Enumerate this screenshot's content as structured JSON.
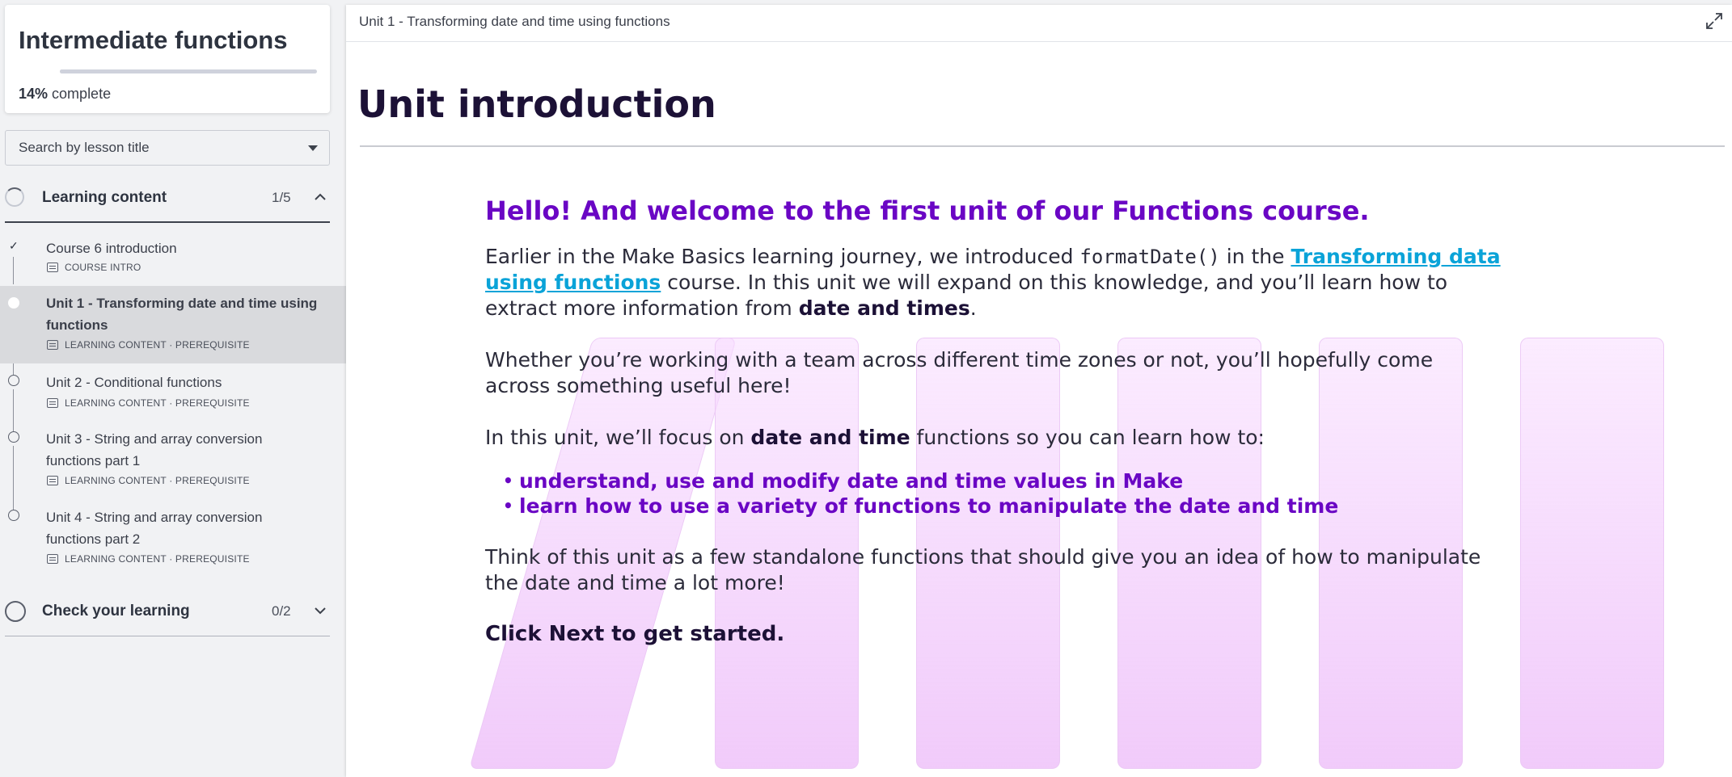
{
  "course": {
    "title": "Intermediate functions",
    "progress_value": 14,
    "progress_pct": "14%",
    "progress_label": "complete"
  },
  "search": {
    "placeholder": "Search by lesson title"
  },
  "sections": [
    {
      "label": "Learning content",
      "count": "1/5",
      "expanded": true
    },
    {
      "label": "Check your learning",
      "count": "0/2",
      "expanded": false
    }
  ],
  "lessons": [
    {
      "title": "Course 6 introduction",
      "meta": "COURSE INTRO",
      "status": "complete"
    },
    {
      "title": "Unit 1 - Transforming date and time using functions",
      "meta": "LEARNING CONTENT · PREREQUISITE",
      "status": "current"
    },
    {
      "title": "Unit 2 - Conditional functions",
      "meta": "LEARNING CONTENT · PREREQUISITE",
      "status": "not-started"
    },
    {
      "title": "Unit 3 - String and array conversion functions part 1",
      "meta": "LEARNING CONTENT · PREREQUISITE",
      "status": "not-started"
    },
    {
      "title": "Unit 4 - String and array conversion functions part 2",
      "meta": "LEARNING CONTENT · PREREQUISITE",
      "status": "not-started"
    }
  ],
  "topbar": {
    "breadcrumb": "Unit 1 - Transforming date and time using functions",
    "expand_icon": "expand-icon"
  },
  "page": {
    "title": "Unit introduction",
    "hello": "Hello! And welcome to the first unit of our Functions course.",
    "p1_a": "Earlier in the Make Basics learning journey, we introduced ",
    "p1_code": "formatDate()",
    "p1_b": " in the ",
    "p1_link": "Transforming data using functions",
    "p1_c": " course. In this unit we will expand on this knowledge, and you’ll learn how to extract more information from ",
    "p1_bold": "date and times",
    "p1_d": ".",
    "p2": "Whether you’re working with a team across different time zones or not, you’ll hopefully come across something useful here!",
    "p3_a": "In this unit, we’ll focus on ",
    "p3_bold": "date and time",
    "p3_b": " functions so you can learn how to:",
    "bullets": [
      "understand, use and modify date and time values in Make",
      "learn how to use a variety of functions to manipulate the date and time"
    ],
    "p4": "Think of this unit as a few standalone functions that should give you an idea of how to manipulate the date and time a lot more!",
    "cta": "Click Next to get started."
  },
  "colors": {
    "accent_purple": "#6a06c4",
    "link_blue": "#0aa3d8",
    "heading_dark": "#1c1136",
    "decor_pink": "#f3cdfb"
  }
}
